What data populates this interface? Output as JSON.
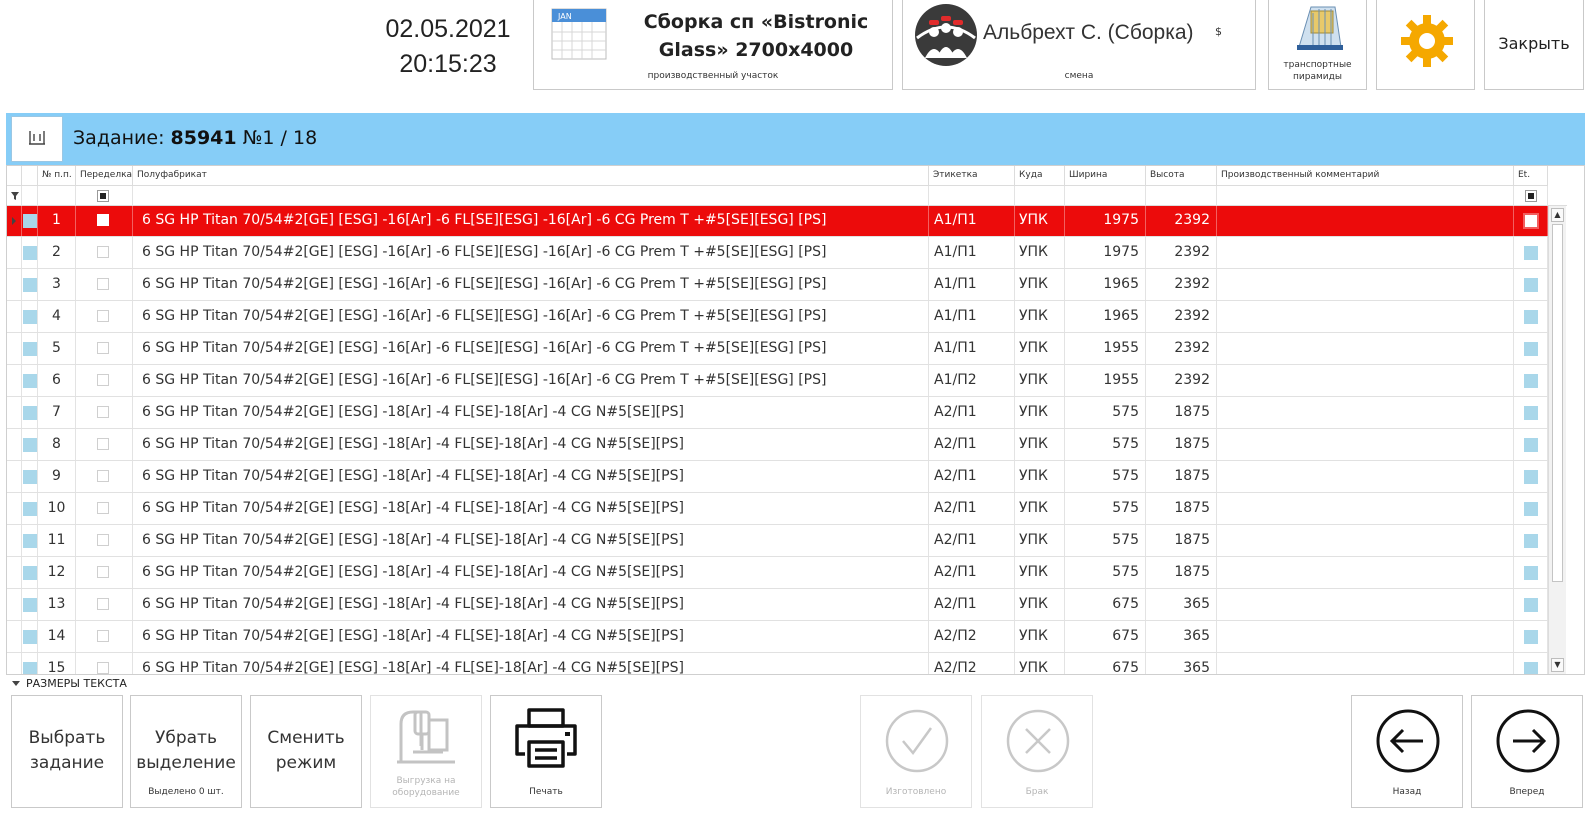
{
  "header": {
    "date": "02.05.2021",
    "time": "20:15:23",
    "area": {
      "name_line1": "Сборка сп «Bistronic",
      "name_line2": "Glass» 2700x4000",
      "caption": "производственный участок",
      "calendar_month": "JAN"
    },
    "shift": {
      "name": "Альбрехт С. (Сборка)",
      "symbol": "$",
      "caption": "смена"
    },
    "pyramids": {
      "caption_line1": "транспортные",
      "caption_line2": "пирамиды"
    },
    "close_label": "Закрыть"
  },
  "task": {
    "prefix": "Задание:",
    "number": "85941",
    "position": "№1 / 18"
  },
  "grid": {
    "columns": {
      "num": "№ п.п.",
      "rework": "Переделка",
      "product": "Полуфабрикат",
      "label": "Этикетка",
      "destination": "Куда",
      "width": "Ширина",
      "height": "Высота",
      "comment": "Производственный комментарий",
      "et": "Et."
    },
    "rows": [
      {
        "num": "1",
        "product": "6 SG HP Titan 70/54#2[GE] [ESG] -16[Ar] -6 FL[SE][ESG] -16[Ar] -6 CG Prem T +#5[SE][ESG] [PS]",
        "label": "А1/П1",
        "destination": "УПК",
        "width": "1975",
        "height": "2392",
        "comment": ""
      },
      {
        "num": "2",
        "product": "6 SG HP Titan 70/54#2[GE] [ESG] -16[Ar] -6 FL[SE][ESG] -16[Ar] -6 CG Prem T +#5[SE][ESG] [PS]",
        "label": "А1/П1",
        "destination": "УПК",
        "width": "1975",
        "height": "2392",
        "comment": ""
      },
      {
        "num": "3",
        "product": "6 SG HP Titan 70/54#2[GE] [ESG] -16[Ar] -6 FL[SE][ESG] -16[Ar] -6 CG Prem T +#5[SE][ESG] [PS]",
        "label": "А1/П1",
        "destination": "УПК",
        "width": "1965",
        "height": "2392",
        "comment": ""
      },
      {
        "num": "4",
        "product": "6 SG HP Titan 70/54#2[GE] [ESG] -16[Ar] -6 FL[SE][ESG] -16[Ar] -6 CG Prem T +#5[SE][ESG] [PS]",
        "label": "А1/П1",
        "destination": "УПК",
        "width": "1965",
        "height": "2392",
        "comment": ""
      },
      {
        "num": "5",
        "product": "6 SG HP Titan 70/54#2[GE] [ESG] -16[Ar] -6 FL[SE][ESG] -16[Ar] -6 CG Prem T +#5[SE][ESG] [PS]",
        "label": "А1/П1",
        "destination": "УПК",
        "width": "1955",
        "height": "2392",
        "comment": ""
      },
      {
        "num": "6",
        "product": "6 SG HP Titan 70/54#2[GE] [ESG] -16[Ar] -6 FL[SE][ESG] -16[Ar] -6 CG Prem T +#5[SE][ESG] [PS]",
        "label": "А1/П2",
        "destination": "УПК",
        "width": "1955",
        "height": "2392",
        "comment": ""
      },
      {
        "num": "7",
        "product": "6 SG HP Titan 70/54#2[GE] [ESG] -18[Ar] -4 FL[SE]-18[Ar] -4 CG N#5[SE][PS]",
        "label": "А2/П1",
        "destination": "УПК",
        "width": "575",
        "height": "1875",
        "comment": ""
      },
      {
        "num": "8",
        "product": "6 SG HP Titan 70/54#2[GE] [ESG] -18[Ar] -4 FL[SE]-18[Ar] -4 CG N#5[SE][PS]",
        "label": "А2/П1",
        "destination": "УПК",
        "width": "575",
        "height": "1875",
        "comment": ""
      },
      {
        "num": "9",
        "product": "6 SG HP Titan 70/54#2[GE] [ESG] -18[Ar] -4 FL[SE]-18[Ar] -4 CG N#5[SE][PS]",
        "label": "А2/П1",
        "destination": "УПК",
        "width": "575",
        "height": "1875",
        "comment": ""
      },
      {
        "num": "10",
        "product": "6 SG HP Titan 70/54#2[GE] [ESG] -18[Ar] -4 FL[SE]-18[Ar] -4 CG N#5[SE][PS]",
        "label": "А2/П1",
        "destination": "УПК",
        "width": "575",
        "height": "1875",
        "comment": ""
      },
      {
        "num": "11",
        "product": "6 SG HP Titan 70/54#2[GE] [ESG] -18[Ar] -4 FL[SE]-18[Ar] -4 CG N#5[SE][PS]",
        "label": "А2/П1",
        "destination": "УПК",
        "width": "575",
        "height": "1875",
        "comment": ""
      },
      {
        "num": "12",
        "product": "6 SG HP Titan 70/54#2[GE] [ESG] -18[Ar] -4 FL[SE]-18[Ar] -4 CG N#5[SE][PS]",
        "label": "А2/П1",
        "destination": "УПК",
        "width": "575",
        "height": "1875",
        "comment": ""
      },
      {
        "num": "13",
        "product": "6 SG HP Titan 70/54#2[GE] [ESG] -18[Ar] -4 FL[SE]-18[Ar] -4 CG N#5[SE][PS]",
        "label": "А2/П1",
        "destination": "УПК",
        "width": "675",
        "height": "365",
        "comment": ""
      },
      {
        "num": "14",
        "product": "6 SG HP Titan 70/54#2[GE] [ESG] -18[Ar] -4 FL[SE]-18[Ar] -4 CG N#5[SE][PS]",
        "label": "А2/П2",
        "destination": "УПК",
        "width": "675",
        "height": "365",
        "comment": ""
      },
      {
        "num": "15",
        "product": "6 SG HP Titan 70/54#2[GE] [ESG] -18[Ar] -4 FL[SE]-18[Ar] -4 CG N#5[SE][PS]",
        "label": "А2/П2",
        "destination": "УПК",
        "width": "675",
        "height": "365",
        "comment": ""
      }
    ]
  },
  "footer": {
    "text_sizes_label": "РАЗМЕРЫ ТЕКСТА",
    "select_task": {
      "line1": "Выбрать",
      "line2": "задание"
    },
    "clear_selection": {
      "line1": "Убрать",
      "line2": "выделение",
      "caption": "Выделено 0 шт."
    },
    "change_mode": {
      "line1": "Сменить",
      "line2": "режим"
    },
    "unload": {
      "line1": "Выгрузка на",
      "line2": "оборудование"
    },
    "print": {
      "caption": "Печать"
    },
    "made": {
      "caption": "Изготовлено"
    },
    "defect": {
      "caption": "Брак"
    },
    "back": {
      "caption": "Назад"
    },
    "forward": {
      "caption": "Вперед"
    }
  },
  "colors": {
    "selected_row": "#ec0b0b",
    "taskbar": "#86cdf7",
    "row_marker": "#a9d7ea",
    "gear": "#f5a800"
  }
}
